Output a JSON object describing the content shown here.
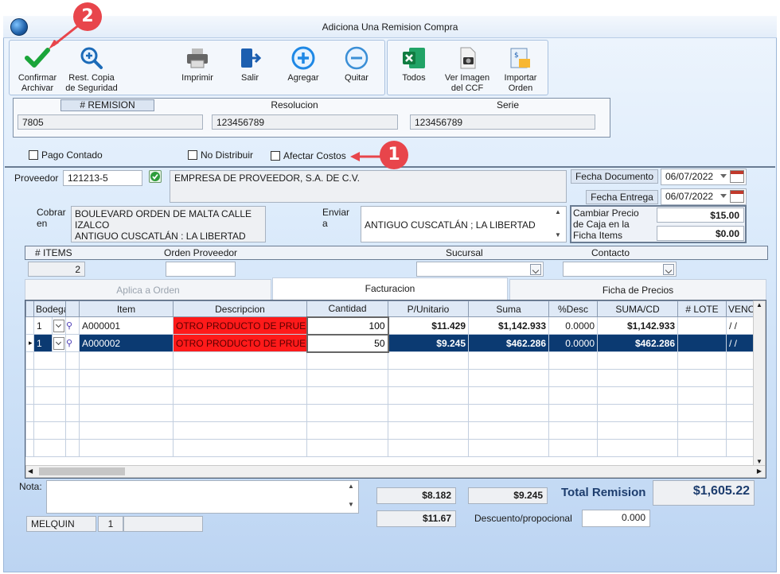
{
  "window": {
    "title": "Adiciona Una Remision Compra"
  },
  "toolbar": {
    "confirm_line1": "Confirmar",
    "confirm_line2": "Archivar",
    "restore_line1": "Rest. Copia",
    "restore_line2": "de Seguridad",
    "print": "Imprimir",
    "exit": "Salir",
    "add": "Agregar",
    "remove": "Quitar",
    "all": "Todos",
    "view_line1": "Ver Imagen",
    "view_line2": "del CCF",
    "import_line1": "Importar",
    "import_line2": "Orden"
  },
  "header": {
    "remision_label": "# REMISION",
    "remision_value": "7805",
    "resolucion_label": "Resolucion",
    "resolucion_value": "123456789",
    "serie_label": "Serie",
    "serie_value": "123456789"
  },
  "options": {
    "pago_contado": "Pago Contado",
    "no_distribuir": "No Distribuir",
    "afectar_costos": "Afectar Costos"
  },
  "annotations": {
    "one": "1",
    "two": "2"
  },
  "supplier": {
    "proveedor_label": "Proveedor",
    "proveedor_code": "121213-5",
    "proveedor_name": "EMPRESA DE PROVEEDOR, S.A. DE C.V.",
    "fecha_documento_label": "Fecha Documento",
    "fecha_documento": "06/07/2022",
    "fecha_entrega_label": "Fecha Entrega",
    "fecha_entrega": "06/07/2022",
    "cobrar_label_1": "Cobrar",
    "cobrar_label_2": "en",
    "cobrar_line1": "BOULEVARD ORDEN DE MALTA CALLE",
    "cobrar_line2": "IZALCO",
    "cobrar_line3": "ANTIGUO CUSCATLÁN : LA LIBERTAD",
    "enviar_label_1": "Enviar",
    "enviar_label_2": "a",
    "enviar_value": "ANTIGUO CUSCATLÁN ; LA LIBERTAD",
    "cambiar_line1": "Cambiar Precio",
    "cambiar_line2": "de Caja en la",
    "cambiar_line3": "Ficha Items",
    "precio_caja": "$15.00",
    "precio_caja2": "$0.00"
  },
  "info_bar": {
    "items_label": "# ITEMS",
    "items_value": "2",
    "orden_label": "Orden Proveedor",
    "sucursal_label": "Sucursal",
    "contacto_label": "Contacto"
  },
  "tabs": {
    "aplica": "Aplica a Orden",
    "facturacion": "Facturacion",
    "ficha": "Ficha de Precios"
  },
  "grid": {
    "columns": [
      "Bodega",
      "",
      "Item",
      "Descripcion",
      "Cantidad",
      "P/Unitario",
      "Suma",
      "%Desc",
      "SUMA/CD",
      "# LOTE",
      "VENC"
    ],
    "rows": [
      {
        "bodega": "1",
        "item": "A000001",
        "descripcion": "OTRO PRODUCTO DE PRUEBA",
        "cantidad": "100",
        "punitario": "$11.429",
        "suma": "$1,142.933",
        "desc": "0.0000",
        "sumacd": "$1,142.933",
        "lote": "",
        "venc": "/ /"
      },
      {
        "bodega": "1",
        "item": "A000002",
        "descripcion": "OTRO PRODUCTO DE PRUEBA",
        "cantidad": "50",
        "punitario": "$9.245",
        "suma": "$462.286",
        "desc": "0.0000",
        "sumacd": "$462.286",
        "lote": "",
        "venc": "/ /"
      }
    ]
  },
  "footer": {
    "nota_label": "Nota:",
    "user": "MELQUIN",
    "user_num": "1",
    "val1": "$8.182",
    "val2": "$9.245",
    "val3": "$11.67",
    "total_label": "Total Remision",
    "total_value": "$1,605.22",
    "descuento_label": "Descuento/propocional",
    "descuento_value": "0.000"
  },
  "colors": {
    "selected_row": "#0b3a72",
    "red_cell": "#ff1a1a",
    "annotation": "#e8454b"
  }
}
